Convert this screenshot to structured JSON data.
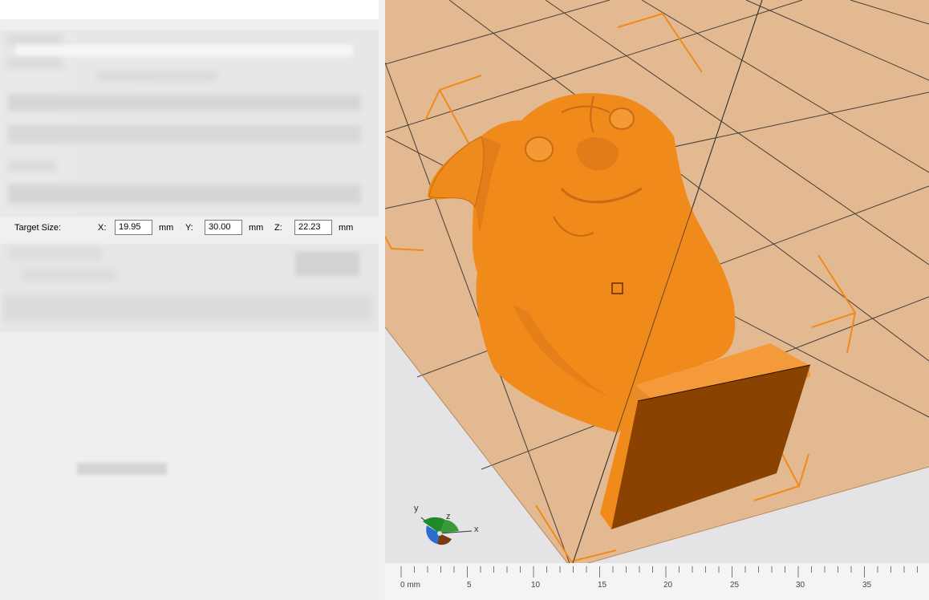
{
  "target_size": {
    "label": "Target Size:",
    "x_label": "X:",
    "x_value": "19.95",
    "x_unit": "mm",
    "y_label": "Y:",
    "y_value": "30.00",
    "y_unit": "mm",
    "z_label": "Z:",
    "z_value": "22.23",
    "z_unit": "mm"
  },
  "ruler": {
    "labels": [
      "0 mm",
      "5",
      "10",
      "15",
      "20",
      "25",
      "30",
      "35"
    ]
  },
  "axes": {
    "x": "x",
    "y": "y",
    "z": "z"
  },
  "colors": {
    "model": "#f08a1a",
    "bed": "#e2b991",
    "bed_corner_marks": "#f08a1a",
    "viewport_bg": "#e4e4e6"
  }
}
